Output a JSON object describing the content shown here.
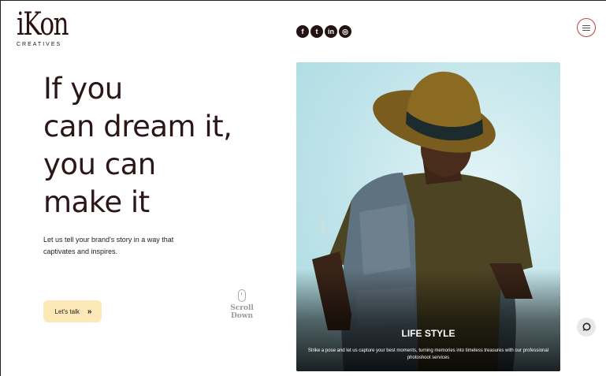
{
  "brand": {
    "name": "iKon",
    "tagline": "CREATIVES"
  },
  "socials": [
    {
      "icon": "facebook-icon",
      "glyph": "f"
    },
    {
      "icon": "twitter-icon",
      "glyph": "t"
    },
    {
      "icon": "linkedin-icon",
      "glyph": "in"
    },
    {
      "icon": "instagram-icon",
      "glyph": "◎"
    }
  ],
  "hero": {
    "headline": [
      "If you",
      "can dream it,",
      "you can",
      "make it"
    ],
    "subtext": "Let us tell your brand's story in a way that captivates and inspires.",
    "cta_label": "Let's talk",
    "cta_icon": "double-chevron-right-icon",
    "scroll_label": "Scroll Down"
  },
  "feature_card": {
    "title": "LIFE STYLE",
    "description": "Strike a pose and let us capture your best moments, turning memories into timeless treasures with our professional photoshoot services"
  },
  "colors": {
    "brand": "#2b1213",
    "menu_ring": "#c0413c",
    "cta_bg": "#fde9b8"
  }
}
